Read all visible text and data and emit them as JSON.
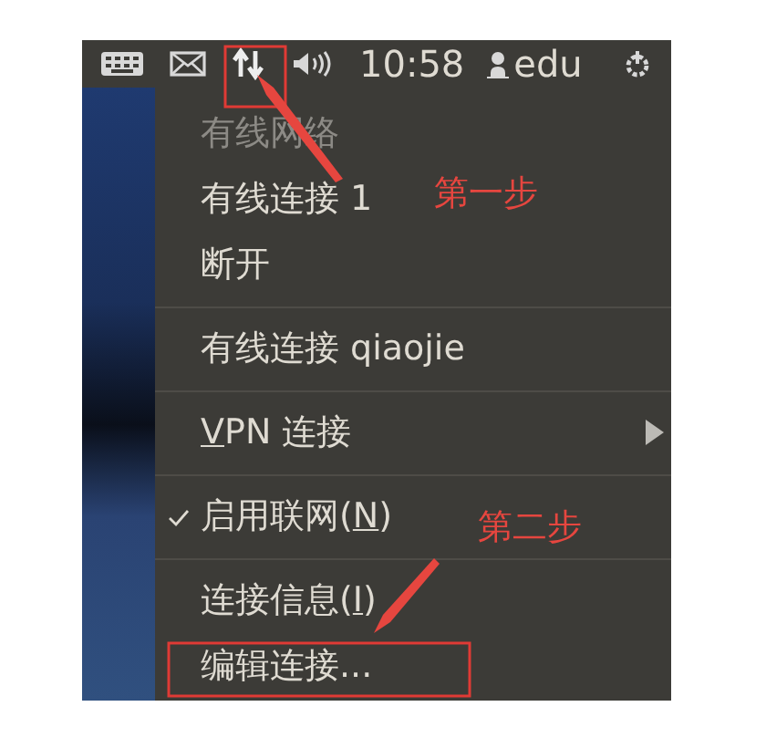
{
  "top_bar": {
    "time": "10:58",
    "user": "edu"
  },
  "menu": {
    "items": [
      {
        "kind": "item",
        "before": "有线网络",
        "disabled": true,
        "checked": false,
        "submenu": false
      },
      {
        "kind": "item",
        "before": "有线连接 1",
        "disabled": false,
        "checked": false,
        "submenu": false
      },
      {
        "kind": "item",
        "before": "断开",
        "disabled": false,
        "checked": false,
        "submenu": false
      },
      {
        "kind": "separator"
      },
      {
        "kind": "item",
        "before": "有线连接 qiaojie",
        "disabled": false,
        "checked": false,
        "submenu": false
      },
      {
        "kind": "separator"
      },
      {
        "kind": "item",
        "mnemonic": "V",
        "after": "PN 连接",
        "disabled": false,
        "checked": false,
        "submenu": true
      },
      {
        "kind": "separator"
      },
      {
        "kind": "item",
        "before": "启用联网(",
        "mnemonic": "N",
        "after": ")",
        "disabled": false,
        "checked": true,
        "submenu": false
      },
      {
        "kind": "separator"
      },
      {
        "kind": "item",
        "before": "连接信息(",
        "mnemonic": "I",
        "after": ")",
        "disabled": false,
        "checked": false,
        "submenu": false
      },
      {
        "kind": "item",
        "before": "编辑连接...",
        "disabled": false,
        "checked": false,
        "submenu": false
      }
    ]
  },
  "annotations": [
    "第一步",
    "第二步"
  ]
}
